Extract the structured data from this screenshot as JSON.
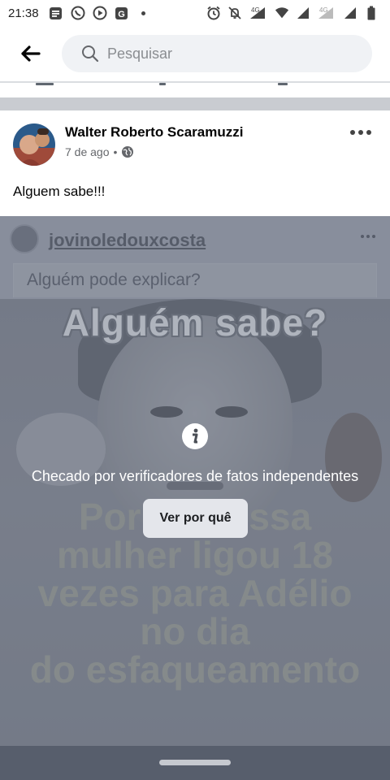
{
  "status_bar": {
    "time": "21:38",
    "left_icons": [
      "messages-icon",
      "whatsapp-icon",
      "youtube-icon",
      "google-news-icon",
      "notification-dot-icon"
    ],
    "right_icons": [
      "alarm-icon",
      "mute-icon",
      "signal-4g-icon",
      "wifi-icon",
      "signal-icon",
      "signal-4g-icon-2",
      "signal-icon-2",
      "battery-icon"
    ],
    "network_label_1": "4G",
    "network_label_2": "4G"
  },
  "search": {
    "placeholder": "Pesquisar",
    "back_icon": "arrow-left-icon",
    "search_icon": "search-icon"
  },
  "post": {
    "author": "Walter Roberto Scaramuzzi",
    "timestamp": "7 de ago",
    "separator": "•",
    "privacy_icon": "globe-icon",
    "text": "Alguem sabe!!!",
    "shared": {
      "username": "jovinoledouxcosta",
      "caption": "Alguém pode explicar?"
    },
    "meme": {
      "title": "Alguém sabe?",
      "body_lines": [
        "Por que essa",
        "mulher ligou 18",
        "vezes para Adélio",
        "no dia",
        "do esfaqueamento"
      ]
    },
    "fact_check": {
      "label": "Checado por verificadores de fatos independentes",
      "button": "Ver por quê"
    }
  },
  "colors": {
    "accent": "#1877f2",
    "overlay": "#6f7787",
    "button_bg": "#e4e6eb"
  }
}
